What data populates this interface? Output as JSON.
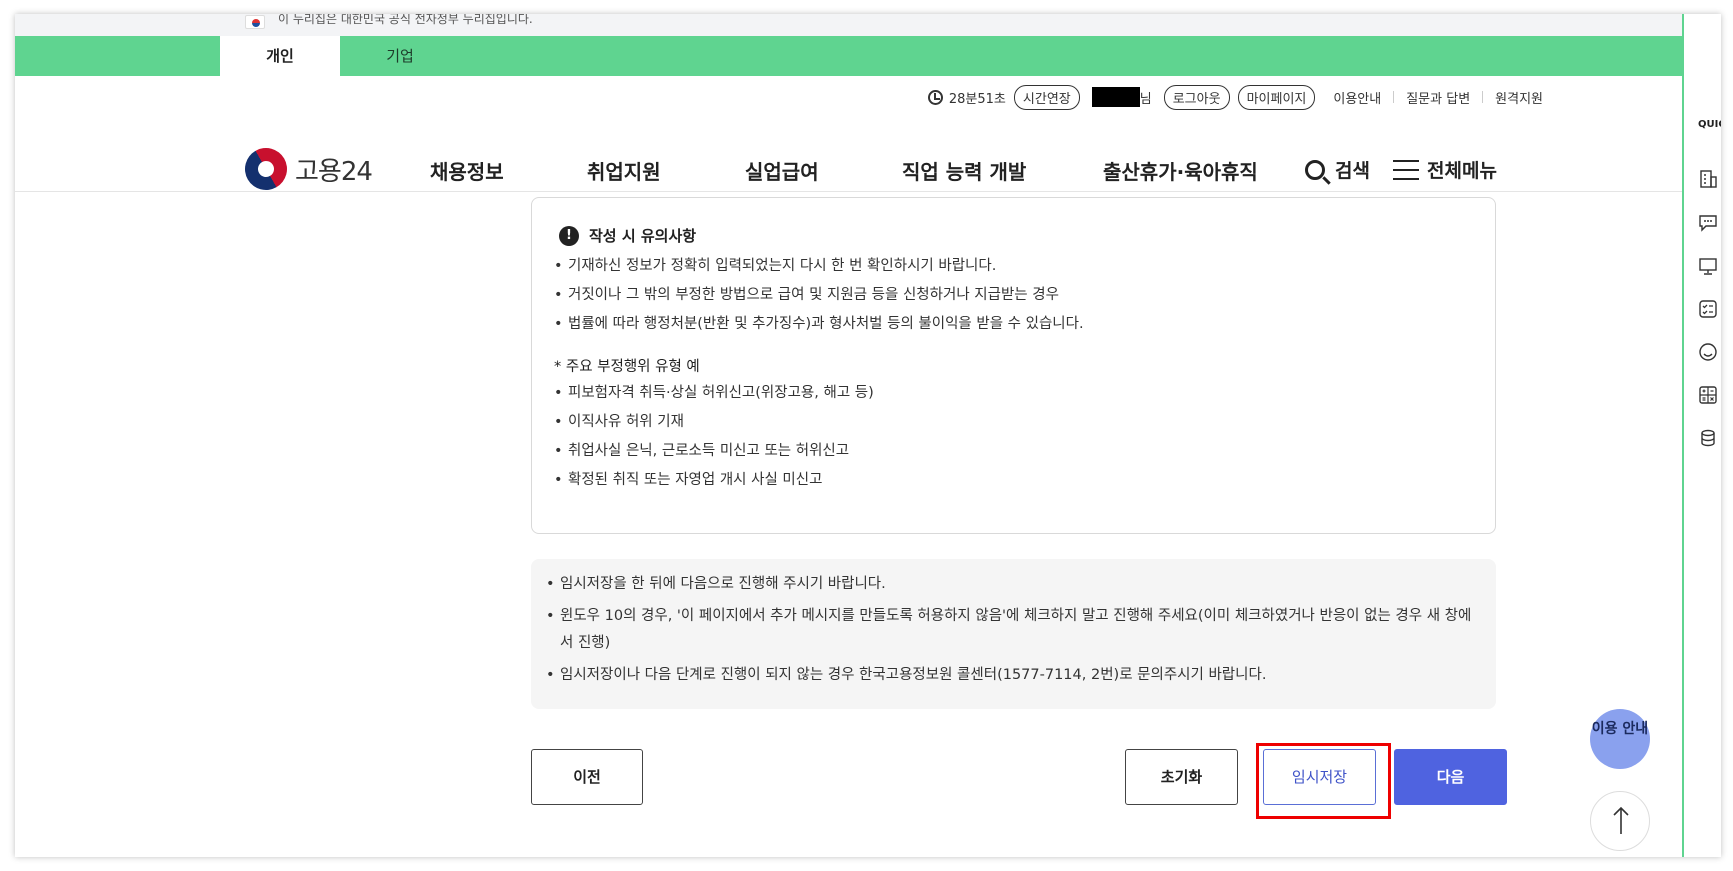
{
  "gov_banner": {
    "text": "이 누리집은 대한민국 공식 전자정부 누리집입니다."
  },
  "tabs": [
    {
      "label": "개인",
      "active": true
    },
    {
      "label": "기업",
      "active": false
    }
  ],
  "utility": {
    "timer": "28분51초",
    "extend_label": "시간연장",
    "user_suffix": "님",
    "logout_label": "로그아웃",
    "mypage_label": "마이페이지",
    "links": [
      "이용안내",
      "질문과 답변",
      "원격지원"
    ]
  },
  "brand": {
    "name": "고용24"
  },
  "nav": {
    "items": [
      "채용정보",
      "취업지원",
      "실업급여",
      "직업 능력 개발",
      "출산휴가·육아휴직"
    ],
    "search_label": "검색",
    "menu_label": "전체메뉴"
  },
  "notice": {
    "title": "작성 시 유의사항",
    "items": [
      "기재하신 정보가 정확히 입력되었는지 다시 한 번 확인하시기 바랍니다.",
      "거짓이나 그 밖의 부정한 방법으로 급여 및 지원금 등을 신청하거나 지급받는 경우",
      "법률에 따라 행정처분(반환 및 추가징수)과 형사처벌 등의 불이익을 받을 수 있습니다."
    ],
    "sub_title": "* 주요 부정행위 유형 예",
    "sub_items": [
      "피보험자격 취득·상실 허위신고(위장고용, 해고 등)",
      "이직사유 허위 기재",
      "취업사실 은닉, 근로소득 미신고 또는 허위신고",
      "확정된 취직 또는 자영업 개시 사실 미신고"
    ]
  },
  "info": {
    "items": [
      "임시저장을 한 뒤에 다음으로 진행해 주시기 바랍니다.",
      "윈도우 10의 경우, '이 페이지에서 추가 메시지를 만들도록 허용하지 않음'에 체크하지 말고 진행해 주세요(이미 체크하였거나 반응이 없는 경우 새 창에서 진행)",
      "임시저장이나 다음 단계로 진행이 되지 않는 경우 한국고용정보원 콜센터(1577-7114, 2번)로 문의주시기 바랍니다."
    ]
  },
  "buttons": {
    "prev": "이전",
    "reset": "초기화",
    "temp_save": "임시저장",
    "next": "다음"
  },
  "quick_menu": {
    "title": "QUICK MENU",
    "icons": [
      "building-icon",
      "chat-icon",
      "monitor-icon",
      "checklist-icon",
      "smile-icon",
      "calculator-icon",
      "coins-icon"
    ]
  },
  "fab": {
    "help_label": "이용 안내"
  },
  "colors": {
    "accent_green": "#5fd490",
    "primary_blue": "#4f63e0",
    "highlight_red": "#ee0000"
  }
}
